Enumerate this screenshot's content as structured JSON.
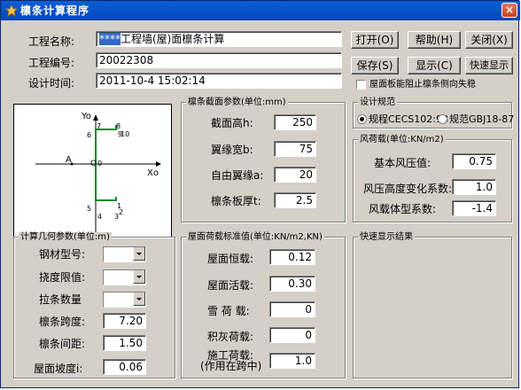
{
  "window": {
    "title": "檩条计算程序",
    "close_glyph": "×"
  },
  "info": {
    "project_name_label": "工程名称:",
    "project_name_highlight": "****",
    "project_name_rest": "工程墙(屋)面檩条计算",
    "project_no_label": "工程编号:",
    "project_no_value": "20022308",
    "design_time_label": "设计时间:",
    "design_time_value": "2011-10-4 15:02:14"
  },
  "buttons": {
    "open": "打开(O)",
    "help": "帮助(H)",
    "close": "关闭(X)",
    "save": "保存(S)",
    "display": "显示(C)",
    "quick_display": "快速显示"
  },
  "roof_checkbox": {
    "label": "屋面板能阻止檩条侧向失稳",
    "checked": false
  },
  "diagram": {
    "y_axis": "Yo",
    "x_axis": "Xo",
    "point_a": "A",
    "origin": "O",
    "origin_index": "0",
    "points": [
      "1",
      "2",
      "3",
      "4",
      "5",
      "6",
      "7",
      "8",
      "9",
      "10"
    ]
  },
  "section": {
    "title": "檩条截面参数(单位:mm)",
    "height_label": "截面高h:",
    "height_value": "250",
    "flange_label": "翼缘宽b:",
    "flange_value": "75",
    "lip_label": "自由翼缘a:",
    "lip_value": "20",
    "thickness_label": "檩条板厚t:",
    "thickness_value": "2.5"
  },
  "code": {
    "title": "设计规范",
    "option1": "规程CECS102:98",
    "option2": "规范GBJ18-87",
    "selected": "option1"
  },
  "wind": {
    "title": "风荷载(单位:KN/m2)",
    "basic_label": "基本风压值:",
    "basic_value": "0.75",
    "height_coef_label": "风压高度变化系数:",
    "height_coef_value": "1.0",
    "shape_coef_label": "风载体型系数:",
    "shape_coef_value": "-1.4"
  },
  "geometry": {
    "title": "计算几何参数(单位:m)",
    "steel_label": "钢材型号:",
    "steel_value": "",
    "deflection_label": "挠度限值:",
    "deflection_value": "",
    "tie_label": "拉条数量",
    "tie_value": "",
    "span_label": "檩条跨度:",
    "span_value": "7.20",
    "spacing_label": "檩条间距:",
    "spacing_value": "1.50",
    "slope_label": "屋面坡度i:",
    "slope_value": "0.06"
  },
  "loads": {
    "title": "屋面荷载标准值(单位:KN/m2,KN)",
    "dead_label": "屋面恒载:",
    "dead_value": "0.12",
    "live_label": "屋面活载:",
    "live_value": "0.30",
    "snow_label": "雪 荷 载:",
    "snow_value": "0",
    "ash_label": "积灰荷载:",
    "ash_value": "0",
    "construction_label_1": "施工荷载:",
    "construction_label_2": "(作用在跨中)",
    "construction_value": "1.0"
  },
  "quick_result": {
    "title": "快速显示结果"
  }
}
